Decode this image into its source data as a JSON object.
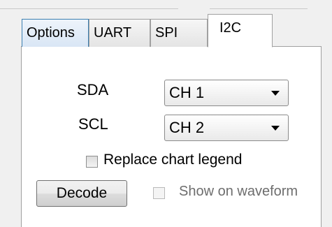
{
  "tabs": [
    {
      "label": "Options",
      "selected": false
    },
    {
      "label": "UART",
      "selected": false
    },
    {
      "label": "SPI",
      "selected": false
    },
    {
      "label": "I2C",
      "selected": true
    }
  ],
  "i2c": {
    "sda_label": "SDA",
    "sda_value": "CH 1",
    "scl_label": "SCL",
    "scl_value": "CH 2",
    "replace_legend_label": "Replace chart legend",
    "replace_legend_checked": false,
    "decode_label": "Decode",
    "show_waveform_label": "Show on waveform",
    "show_waveform_checked": false,
    "show_waveform_enabled": false
  },
  "icons": {
    "dropdown": "chevron-down-icon"
  }
}
